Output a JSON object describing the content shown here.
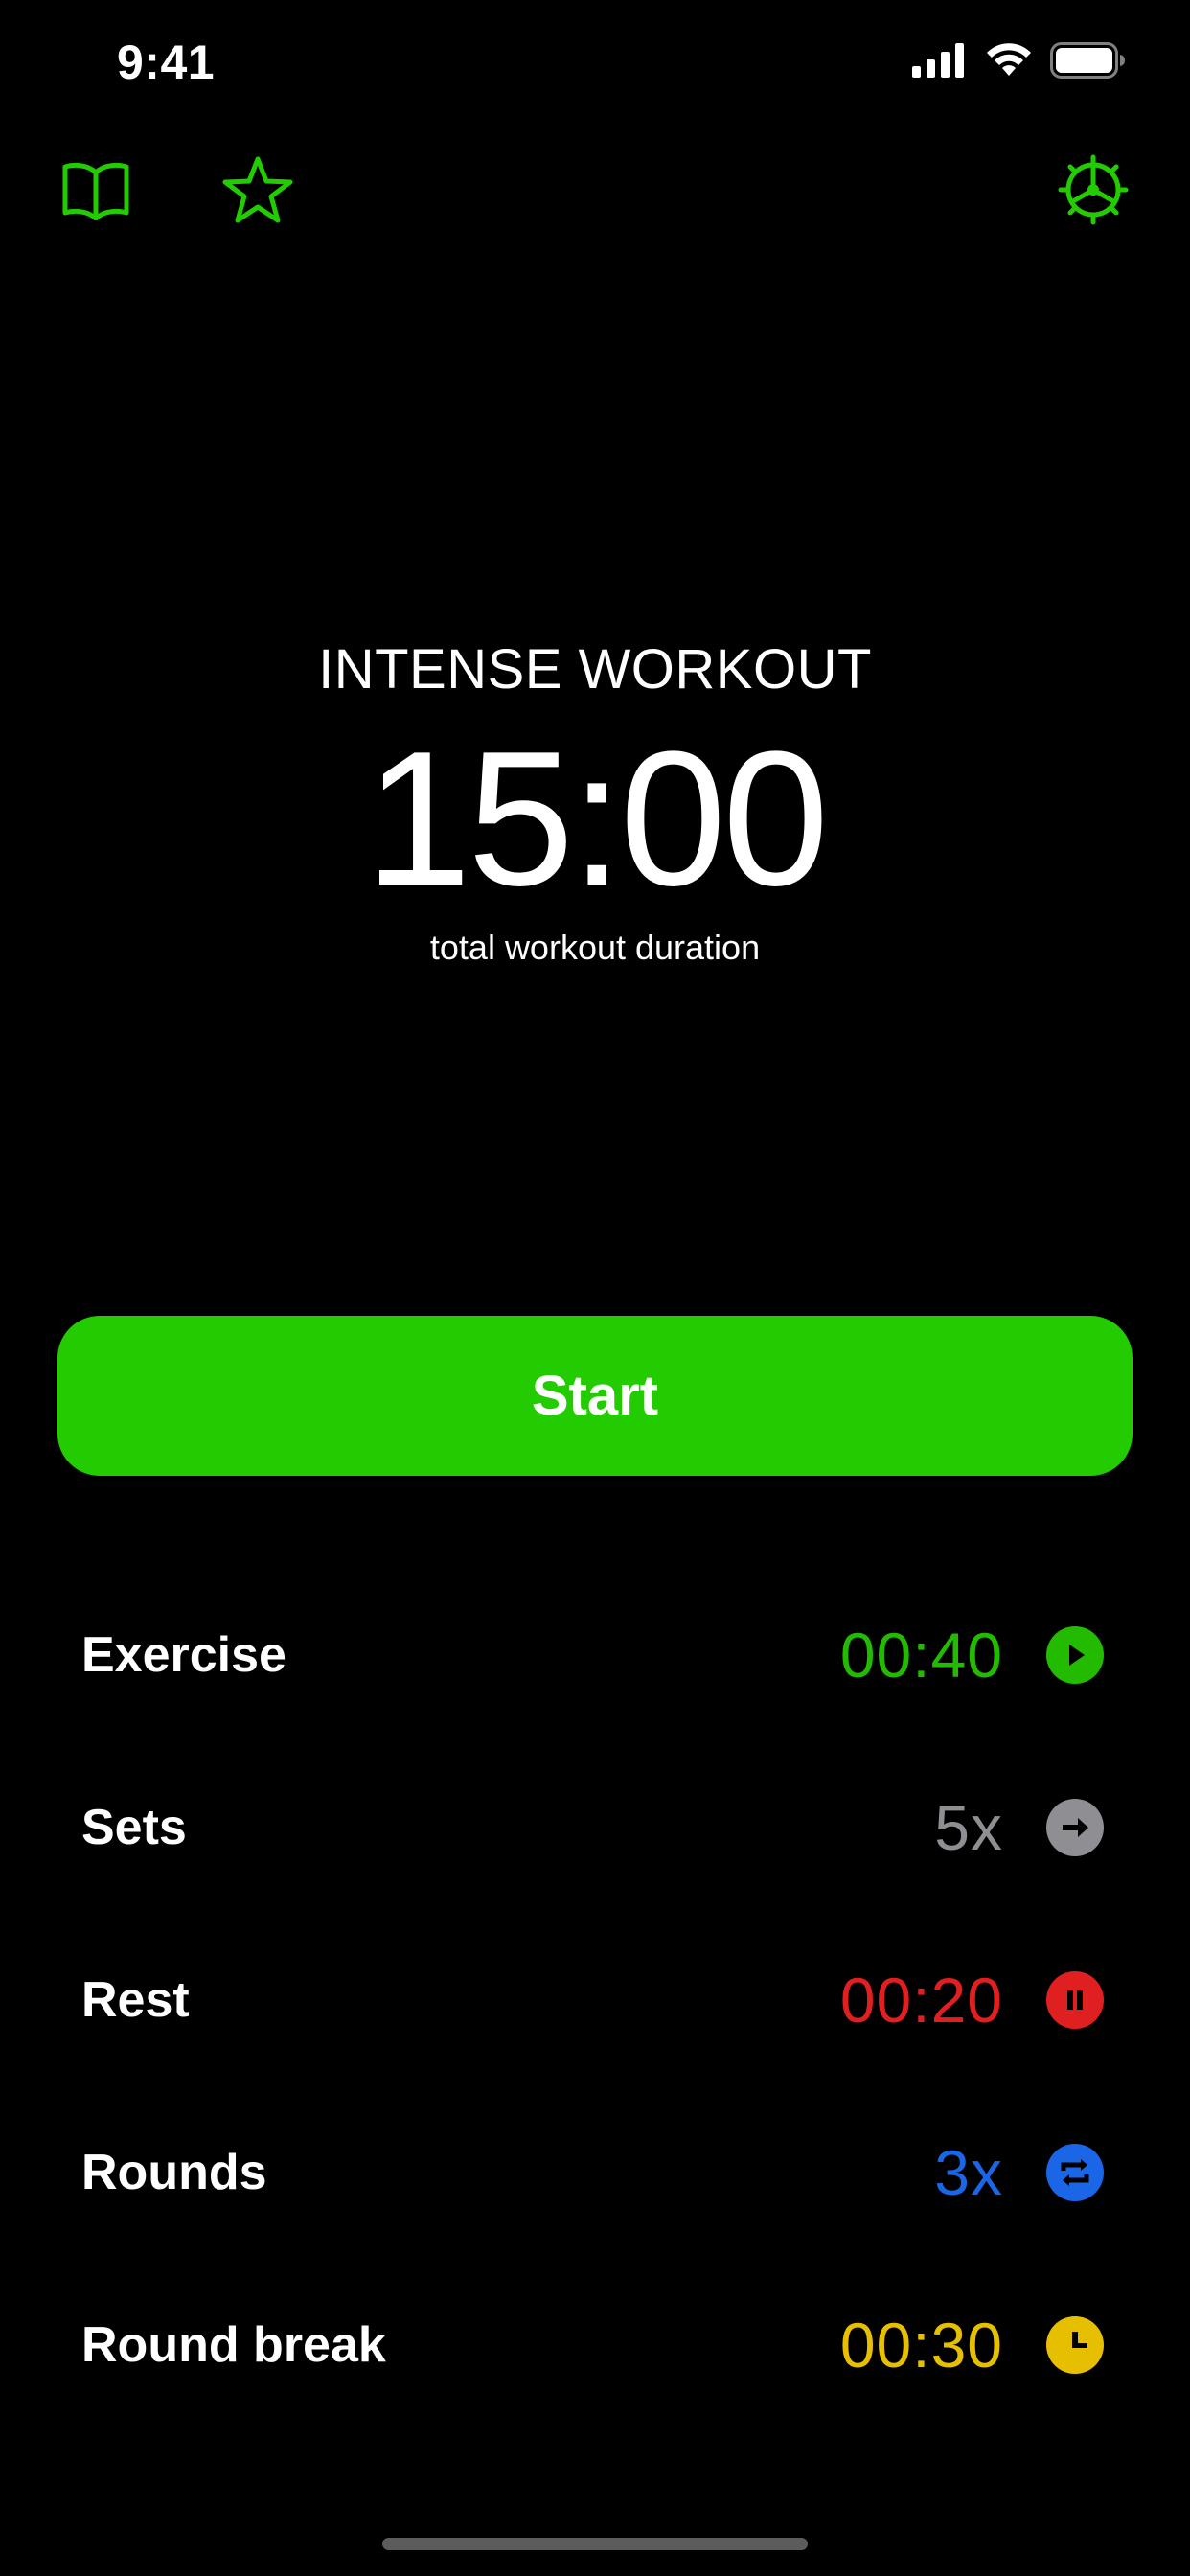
{
  "status_bar": {
    "time": "9:41"
  },
  "toolbar": {
    "left_icons": [
      "book-icon",
      "star-icon"
    ],
    "right_icon": "gear-icon",
    "accent_color": "#22cc00"
  },
  "workout": {
    "title": "INTENSE WORKOUT",
    "duration": "15:00",
    "subtitle": "total workout duration"
  },
  "start_button": {
    "label": "Start",
    "color": "#22cc00"
  },
  "settings": [
    {
      "label": "Exercise",
      "value": "00:40",
      "color": "#22bb00",
      "icon": "play-icon"
    },
    {
      "label": "Sets",
      "value": "5x",
      "color": "#8e8e93",
      "icon": "arrow-right-icon"
    },
    {
      "label": "Rest",
      "value": "00:20",
      "color": "#e02020",
      "icon": "pause-icon"
    },
    {
      "label": "Rounds",
      "value": "3x",
      "color": "#1a66e6",
      "icon": "repeat-icon"
    },
    {
      "label": "Round break",
      "value": "00:30",
      "color": "#e6c000",
      "icon": "clock-icon"
    }
  ]
}
